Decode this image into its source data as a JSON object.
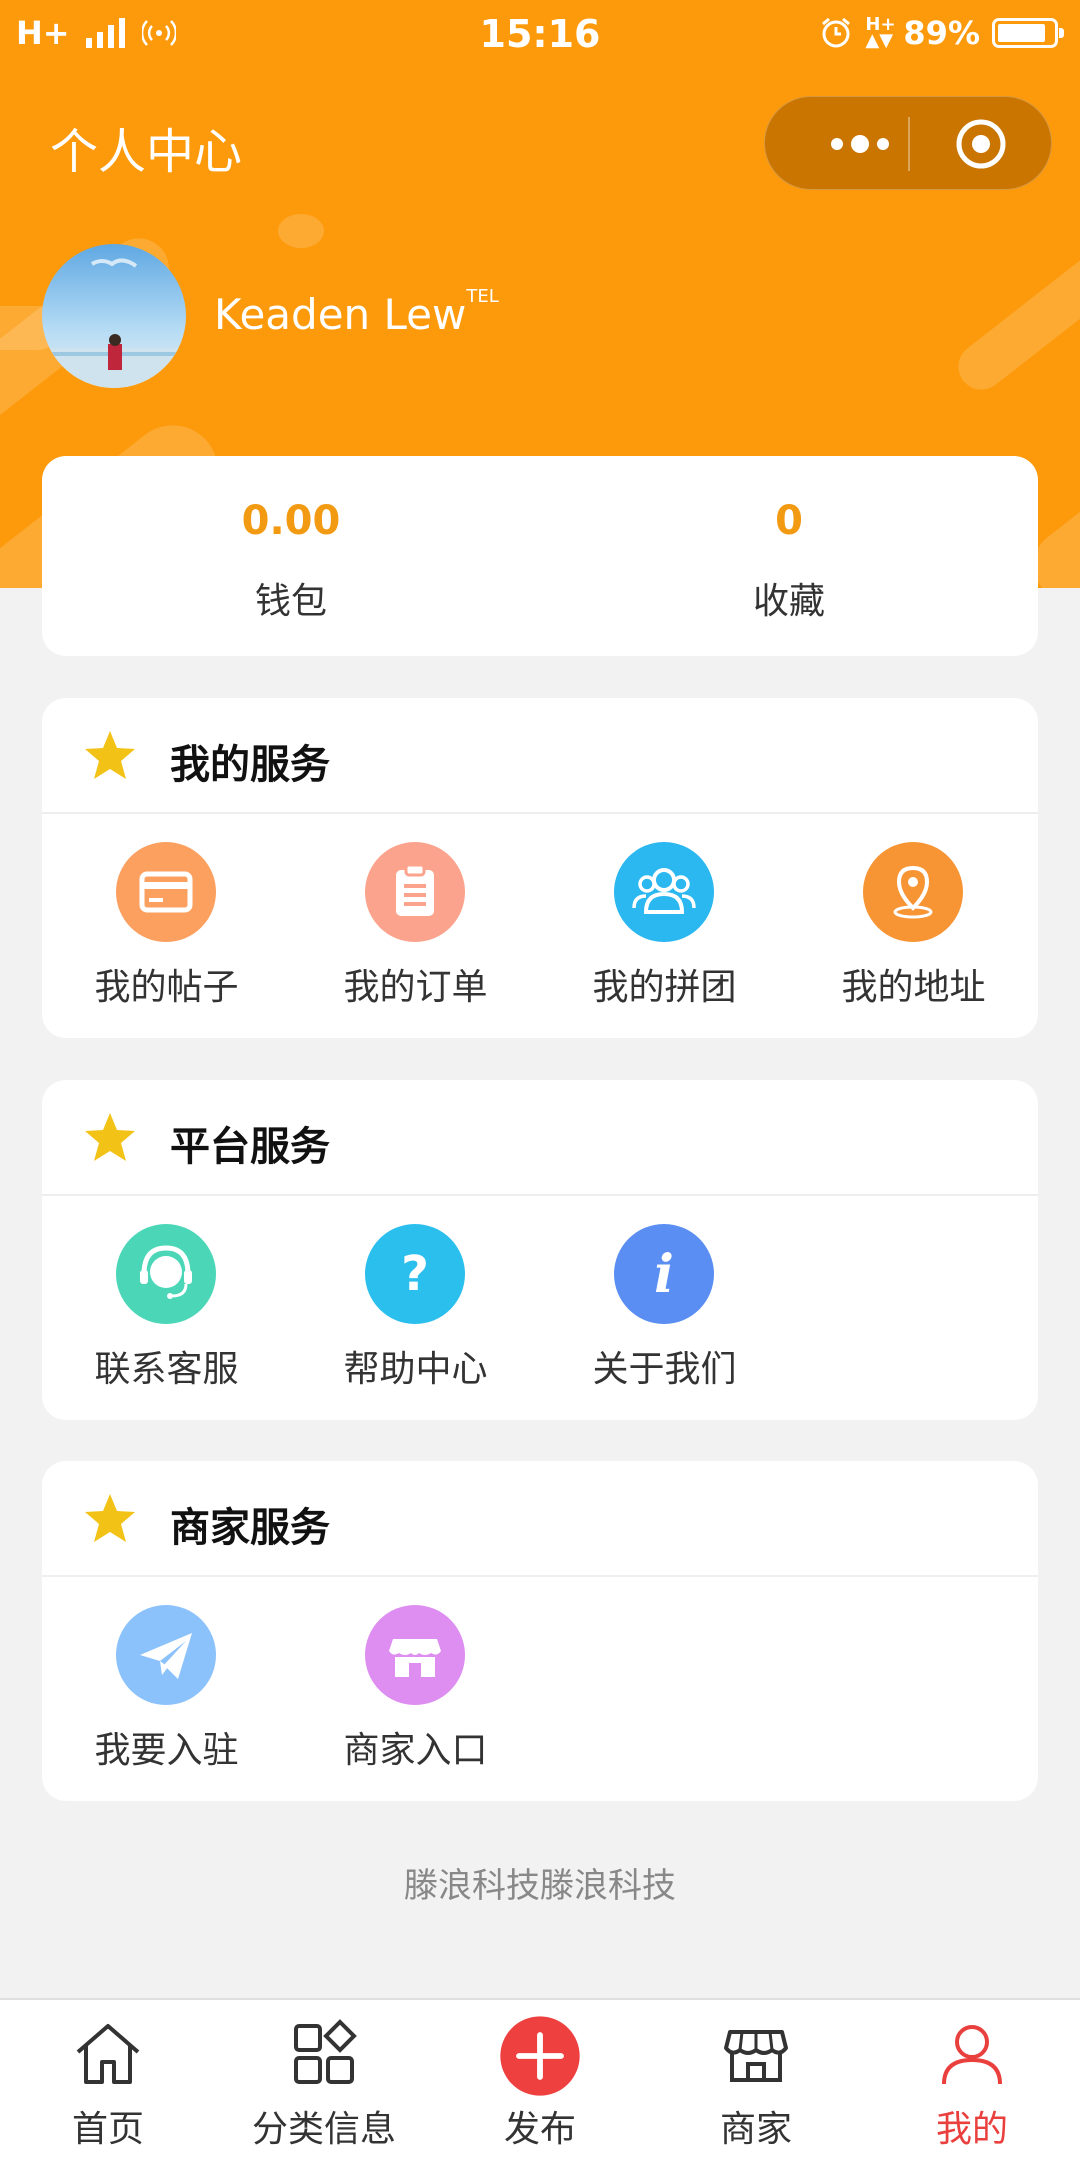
{
  "status_bar": {
    "network": "H+",
    "time": "15:16",
    "battery_percent": 89,
    "battery_label": "89%"
  },
  "header": {
    "title": "个人中心"
  },
  "profile": {
    "username": "Keaden Lew",
    "username_badge": "TEL"
  },
  "stats": [
    {
      "value": "0.00",
      "label": "钱包"
    },
    {
      "value": "0",
      "label": "收藏"
    }
  ],
  "sections": [
    {
      "title": "我的服务",
      "items": [
        {
          "label": "我的帖子",
          "icon": "card-icon",
          "color": "#fca05f"
        },
        {
          "label": "我的订单",
          "icon": "clipboard-icon",
          "color": "#fba38c"
        },
        {
          "label": "我的拼团",
          "icon": "group-icon",
          "color": "#2bb7f0"
        },
        {
          "label": "我的地址",
          "icon": "location-pin-icon",
          "color": "#f79535"
        }
      ]
    },
    {
      "title": "平台服务",
      "items": [
        {
          "label": "联系客服",
          "icon": "customer-service-icon",
          "color": "#4bd7b7"
        },
        {
          "label": "帮助中心",
          "icon": "question-icon",
          "color": "#2bbfee"
        },
        {
          "label": "关于我们",
          "icon": "info-icon",
          "color": "#5b8ef2"
        }
      ]
    },
    {
      "title": "商家服务",
      "items": [
        {
          "label": "我要入驻",
          "icon": "paper-plane-icon",
          "color": "#8cc2fb"
        },
        {
          "label": "商家入口",
          "icon": "storefront-icon",
          "color": "#dd8ef0"
        }
      ]
    }
  ],
  "footer": {
    "text": "滕浪科技滕浪科技"
  },
  "tabbar": [
    {
      "label": "首页",
      "icon": "home-icon"
    },
    {
      "label": "分类信息",
      "icon": "category-icon"
    },
    {
      "label": "发布",
      "icon": "plus-icon"
    },
    {
      "label": "商家",
      "icon": "store-icon"
    },
    {
      "label": "我的",
      "icon": "user-icon",
      "active": true
    }
  ],
  "colors": {
    "header_bg": "#fd9a0c",
    "accent_number": "#f29a11",
    "active_tab": "#e9403d",
    "star": "#f2c217",
    "publish_button": "#ef4040"
  }
}
